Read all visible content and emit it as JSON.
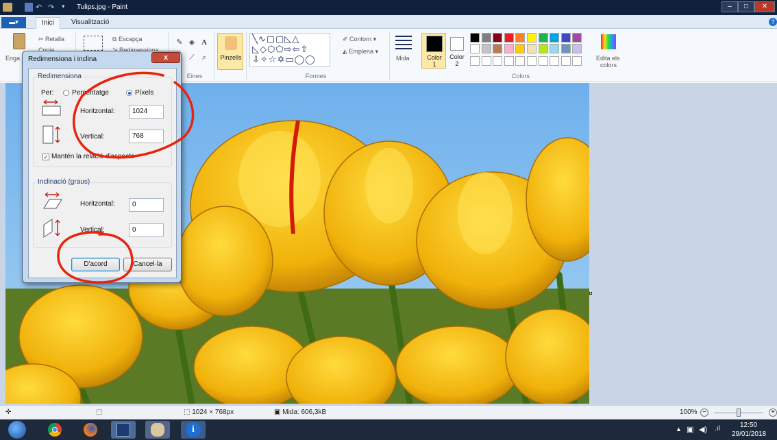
{
  "window": {
    "title": "Tulips.jpg - Paint",
    "minimize": "–",
    "maximize": "□",
    "close": "✕"
  },
  "tabs": {
    "file": "▬▾",
    "home": "Inici",
    "view": "Visualització",
    "help": "?"
  },
  "ribbon": {
    "clipboard": {
      "paste": "Enga",
      "cut": "Retalla",
      "copy": "Copia"
    },
    "image": {
      "crop": "Escapça",
      "resize": "Redimensiona"
    },
    "tools_label": "Eines",
    "brushes": "Pinzells",
    "shapes": {
      "outline": "Contorn",
      "fill": "Emplena",
      "label": "Formes"
    },
    "size": "Mida",
    "color1": {
      "name": "Color",
      "num": "1"
    },
    "color2": {
      "name": "Color",
      "num": "2"
    },
    "colors_label": "Colors",
    "edit_colors": [
      "Edita els",
      "colors"
    ],
    "palette_row1": [
      "#000000",
      "#7f7f7f",
      "#880015",
      "#ed1c24",
      "#ff7f27",
      "#fff200",
      "#22b14c",
      "#00a2e8",
      "#3f48cc",
      "#a349a4"
    ],
    "palette_row2": [
      "#ffffff",
      "#c3c3c3",
      "#b97a57",
      "#ffaec9",
      "#ffc90e",
      "#efe4b0",
      "#b5e61d",
      "#99d9ea",
      "#7092be",
      "#c8bfe7"
    ]
  },
  "dialog": {
    "title": "Redimensiona i inclina",
    "close": "x",
    "resize": {
      "heading": "Redimensiona",
      "by_label": "Per:",
      "percent_label": "Percentatge",
      "pixels_label": "Píxels",
      "horizontal_label": "Horitzontal:",
      "horizontal_value": "1024",
      "vertical_label": "Vertical:",
      "vertical_value": "768",
      "keep_ratio_label": "Mantén la relació d'aspecte"
    },
    "skew": {
      "heading": "Inclinació (graus)",
      "horizontal_label": "Horitzontal:",
      "horizontal_value": "0",
      "vertical_label": "Vertical:",
      "vertical_value": "0"
    },
    "ok": "D'acord",
    "cancel": "Cancel·la"
  },
  "status": {
    "dimensions": "1024 × 768px",
    "size": "Mida: 606,3kB",
    "zoom": "100%"
  },
  "taskbar": {
    "time": "12:50",
    "date": "29/01/2018"
  },
  "colors": {
    "annotation": "#e8230c",
    "titlebar": "#10213d",
    "photo_sky": "#7ab4e8",
    "tulip": "#f2b80f"
  }
}
